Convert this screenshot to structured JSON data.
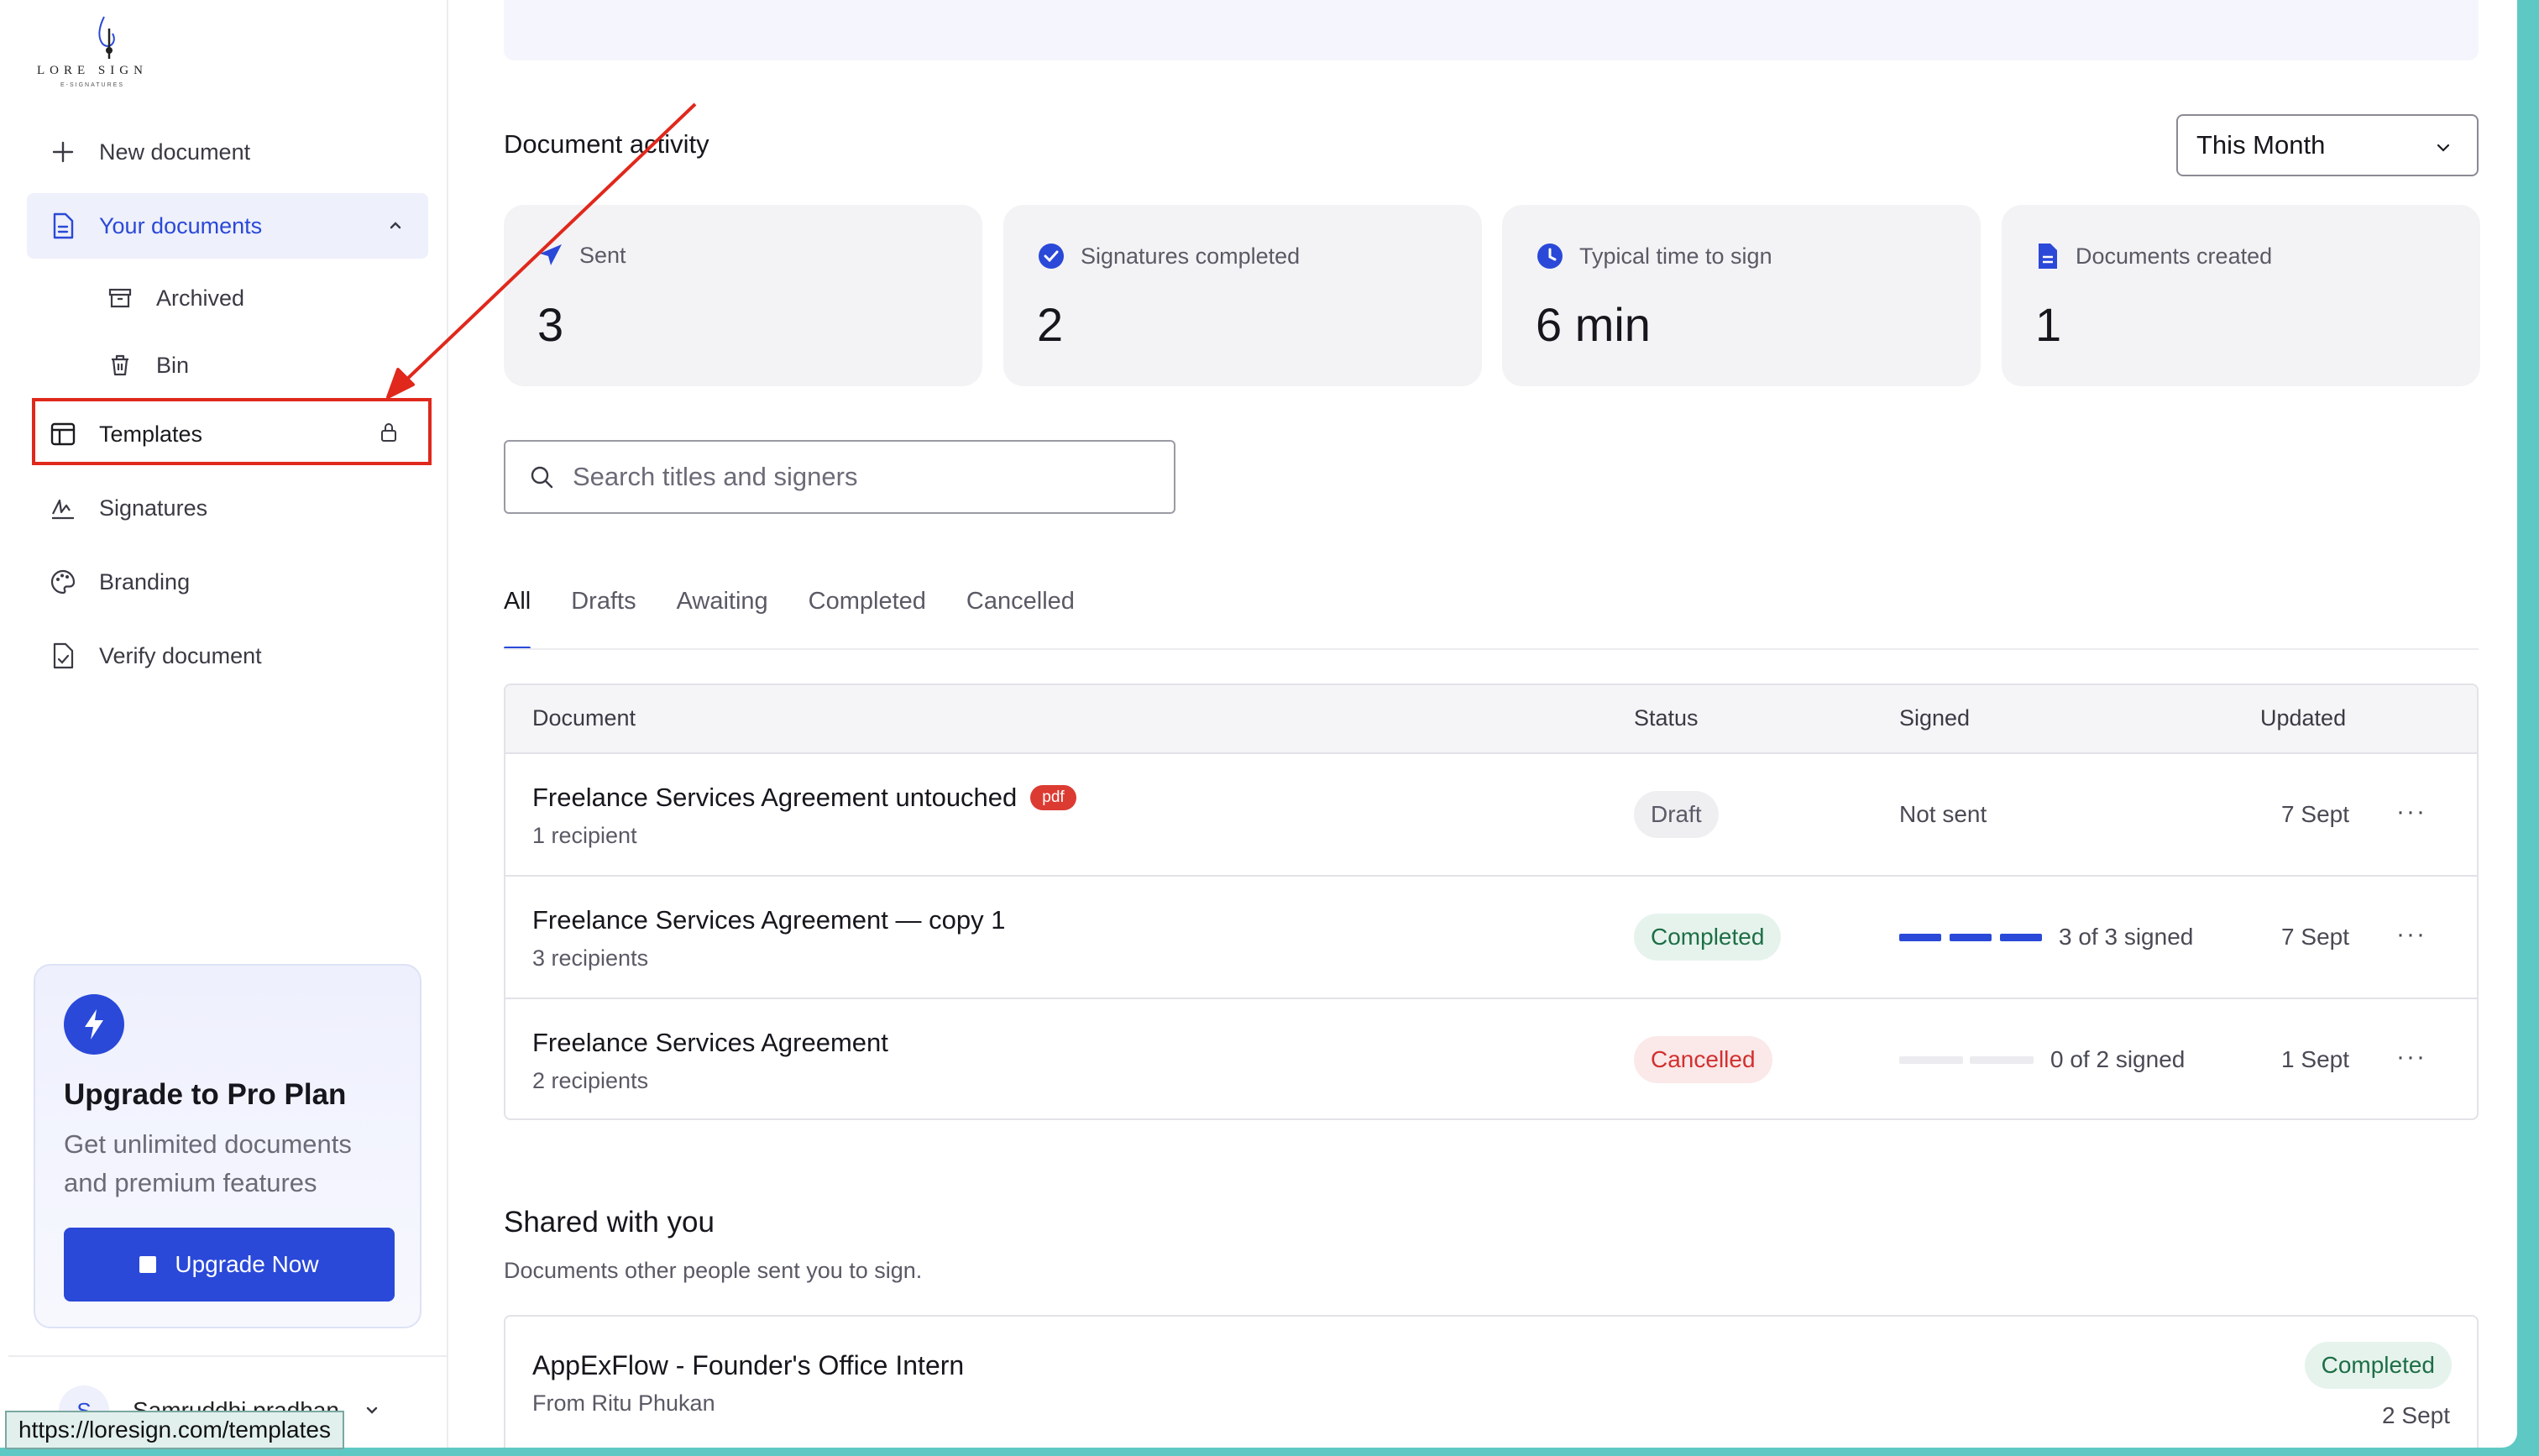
{
  "brand": {
    "name": "LORE SIGN",
    "tagline": "E-SIGNATURES"
  },
  "sidebar": {
    "items": [
      {
        "label": "New document",
        "icon": "plus-icon"
      },
      {
        "label": "Your documents",
        "icon": "document-icon"
      },
      {
        "label": "Archived",
        "icon": "archive-icon"
      },
      {
        "label": "Bin",
        "icon": "trash-icon"
      },
      {
        "label": "Templates",
        "icon": "layout-icon"
      },
      {
        "label": "Signatures",
        "icon": "signature-icon"
      },
      {
        "label": "Branding",
        "icon": "palette-icon"
      },
      {
        "label": "Verify document",
        "icon": "file-check-icon"
      }
    ],
    "upgrade": {
      "title": "Upgrade to Pro Plan",
      "text": "Get unlimited documents and premium features",
      "button": "Upgrade Now"
    },
    "user": {
      "initial": "S",
      "name": "Samruddhi pradhan"
    }
  },
  "status_url": "https://loresign.com/templates",
  "activity": {
    "title": "Document activity",
    "period": "This Month",
    "stats": [
      {
        "label": "Sent",
        "value": "3",
        "icon": "send-icon"
      },
      {
        "label": "Signatures completed",
        "value": "2",
        "icon": "check-badge-icon"
      },
      {
        "label": "Typical time to sign",
        "value": "6 min",
        "icon": "clock-icon"
      },
      {
        "label": "Documents created",
        "value": "1",
        "icon": "file-icon"
      }
    ]
  },
  "search": {
    "placeholder": "Search titles and signers",
    "value": ""
  },
  "tabs": [
    "All",
    "Drafts",
    "Awaiting",
    "Completed",
    "Cancelled"
  ],
  "table": {
    "headers": {
      "document": "Document",
      "status": "Status",
      "signed": "Signed",
      "updated": "Updated"
    },
    "rows": [
      {
        "title": "Freelance Services Agreement untouched",
        "badge": "pdf",
        "recipients": "1 recipient",
        "status": "Draft",
        "signed": "Not sent",
        "signed_count": 0,
        "total": 0,
        "updated": "7 Sept"
      },
      {
        "title": "Freelance Services Agreement — copy 1",
        "badge": "",
        "recipients": "3 recipients",
        "status": "Completed",
        "signed": "3 of 3 signed",
        "signed_count": 3,
        "total": 3,
        "updated": "7 Sept"
      },
      {
        "title": "Freelance Services Agreement",
        "badge": "",
        "recipients": "2 recipients",
        "status": "Cancelled",
        "signed": "0 of 2 signed",
        "signed_count": 0,
        "total": 2,
        "updated": "1 Sept"
      }
    ],
    "more": "···"
  },
  "shared": {
    "title": "Shared with you",
    "subtitle": "Documents other people sent you to sign.",
    "items": [
      {
        "title": "AppExFlow - Founder's Office Intern",
        "from": "From Ritu Phukan",
        "status": "Completed",
        "date": "2 Sept"
      }
    ]
  },
  "colors": {
    "accent": "#2a49d8",
    "annotation": "#e0281c",
    "completed": "#1e6e45",
    "cancelled": "#d23030"
  }
}
